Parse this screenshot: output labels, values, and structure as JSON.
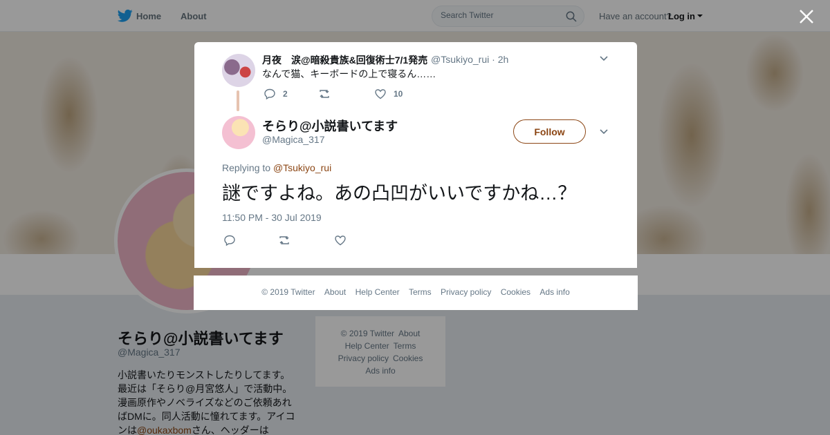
{
  "nav": {
    "home": "Home",
    "about": "About",
    "search_placeholder": "Search Twitter",
    "account_prompt": "Have an account?",
    "login": "Log in"
  },
  "profile": {
    "name": "そらり@小説書いてます",
    "handle": "@Magica_317",
    "bio_lines": [
      "小説書いたりモンストしたりしてます。",
      "最近は「そらり@月宮悠人」で活動中。",
      "漫画原作やノベライズなどのご依頼あれ",
      "ばDMに。同人活動に憧れてます。アイコ"
    ],
    "bio_last_prefix": "ンは",
    "bio_mention": "@oukaxbom",
    "bio_last_suffix": "さん、ヘッダーは"
  },
  "side_footer": {
    "line1a": "© 2019 Twitter",
    "line1b": "About",
    "line2a": "Help Center",
    "line2b": "Terms",
    "line3a": "Privacy policy",
    "line3b": "Cookies",
    "line4": "Ads info"
  },
  "parent_tweet": {
    "name": "月夜　涙@暗殺貴族&回復術士7/1発売",
    "handle": "@Tsukiyo_rui",
    "time": "· 2h",
    "text": "なんで猫、キーボードの上で寝るん……",
    "replies": "2",
    "retweets": "",
    "likes": "10"
  },
  "main_tweet": {
    "name": "そらり@小説書いてます",
    "handle": "@Magica_317",
    "follow_label": "Follow",
    "replying_prefix": "Replying to",
    "replying_to": "@Tsukiyo_rui",
    "text": "謎ですよね。あの凸凹がいいですかね…？",
    "timestamp": "11:50 PM - 30 Jul 2019"
  },
  "modal_footer": {
    "copyright": "© 2019 Twitter",
    "about": "About",
    "help": "Help Center",
    "terms": "Terms",
    "privacy": "Privacy policy",
    "cookies": "Cookies",
    "ads": "Ads info"
  },
  "colors": {
    "accent": "#8b4513",
    "twitter_blue": "#1da1f2",
    "muted": "#657786"
  }
}
